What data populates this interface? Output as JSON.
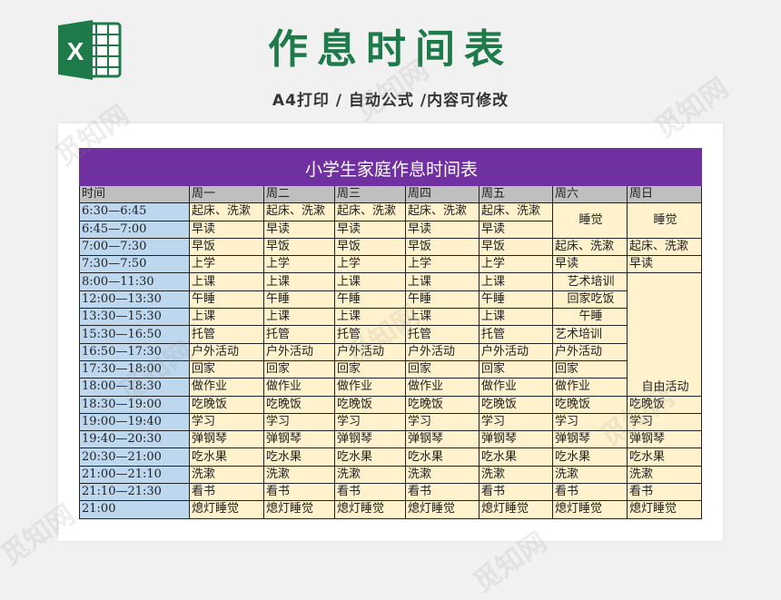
{
  "header": {
    "title": "作息时间表",
    "subtitle": "A4打印 / 自动公式 /内容可修改",
    "logo_letter": "X",
    "watermark": "觅知网"
  },
  "sheet": {
    "title": "小学生家庭作息时间表",
    "columns": [
      "时间",
      "周一",
      "周二",
      "周三",
      "周四",
      "周五",
      "周六",
      "周日"
    ],
    "times": [
      "6:30—6:45",
      "6:45—7:00",
      "7:00—7:30",
      "7:30—7:50",
      "8:00—11:30",
      "12:00—13:30",
      "13:30—15:30",
      "15:30—16:50",
      "16:50—17:30",
      "17:30—18:00",
      "18:00—18:30",
      "18:30—19:00",
      "19:00—19:40",
      "19:40—20:30",
      "20:30—21:00",
      "21:00—21:10",
      "21:10—21:30",
      "21:00"
    ],
    "weekday": [
      "起床、洗漱",
      "早读",
      "早饭",
      "上学",
      "上课",
      "午睡",
      "上课",
      "托管",
      "户外活动",
      "回家",
      "做作业",
      "吃晚饭",
      "学习",
      "弹钢琴",
      "吃水果",
      "洗漱",
      "看书",
      "熄灯睡觉"
    ],
    "saturday": {
      "sleep": "睡觉",
      "breakfast": "起床、洗漱",
      "study": "早读",
      "class1": "艺术培训",
      "lunch": "回家吃饭",
      "nap": "午睡",
      "class2": "艺术培训",
      "outdoor": "户外活动",
      "home": "回家",
      "homework": "做作业",
      "dinner": "吃晚饭",
      "learn": "学习",
      "piano": "弹钢琴",
      "fruit": "吃水果",
      "wash": "洗漱",
      "read": "看书",
      "bed": "熄灯睡觉"
    },
    "sunday": {
      "sleep": "睡觉",
      "breakfast": "起床、洗漱",
      "study": "早读",
      "free": "自由活动",
      "dinner": "吃晚饭",
      "learn": "学习",
      "piano": "弹钢琴",
      "fruit": "吃水果",
      "wash": "洗漱",
      "read": "看书",
      "bed": "熄灯睡觉"
    }
  },
  "colors": {
    "brand_green": "#1f7a4a",
    "banner_purple": "#7030a0",
    "header_gray": "#bfbfbf",
    "time_blue": "#bdd7ee",
    "cell_yellow": "#fff2cc"
  }
}
